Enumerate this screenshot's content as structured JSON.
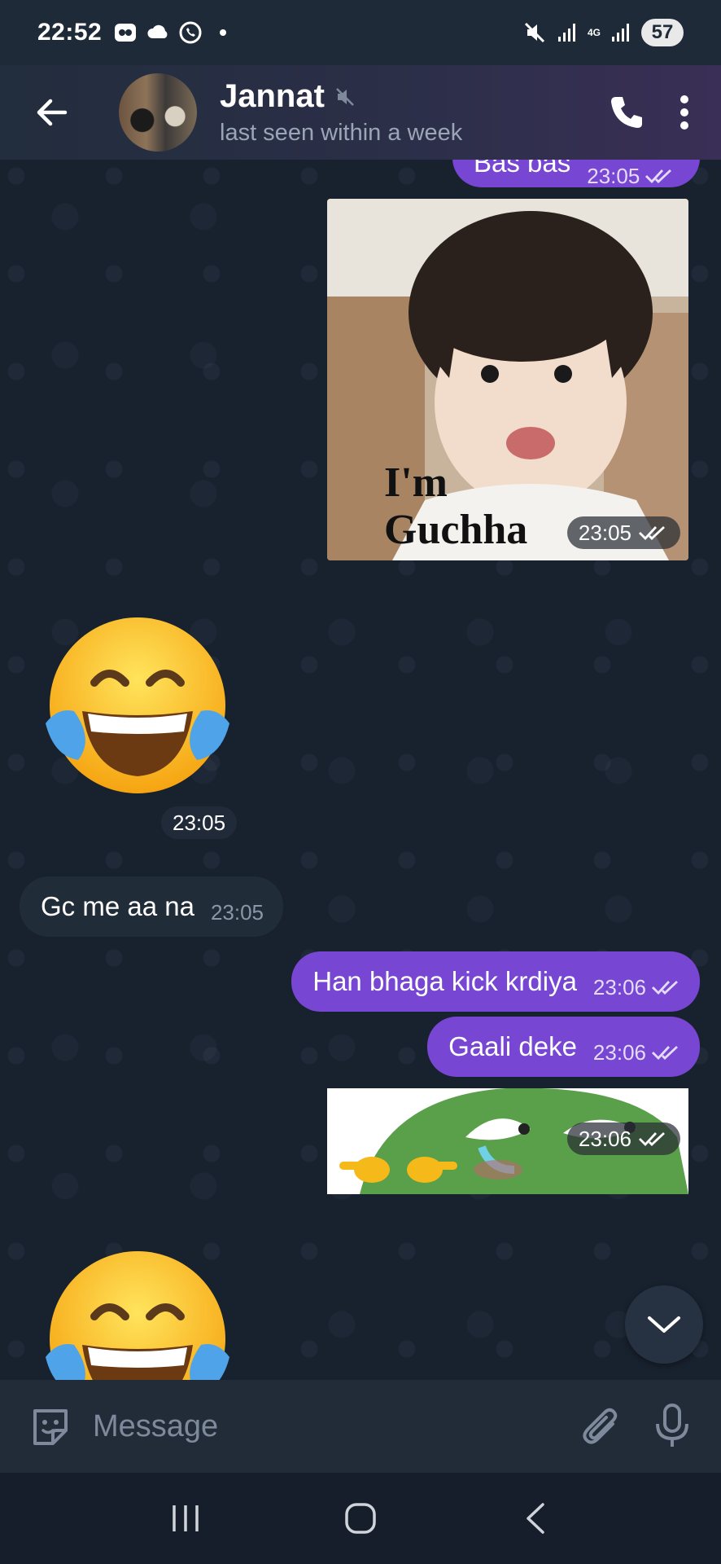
{
  "status_bar": {
    "time": "22:52",
    "battery": "57",
    "network": "4G",
    "icons": [
      "app-icon",
      "cloud-icon",
      "whatsapp-icon",
      "dot-icon",
      "mute-icon",
      "signal-icon",
      "signal-icon"
    ]
  },
  "header": {
    "contact_name": "Jannat",
    "last_seen": "last seen within a week",
    "muted": true
  },
  "messages": {
    "top_partial": {
      "text": "Bas bas",
      "time": "23:05"
    },
    "photo": {
      "caption_line1": "I'm",
      "caption_line2": "Guchha",
      "time": "23:05"
    },
    "emoji_1": {
      "time": "23:05"
    },
    "incoming_1": {
      "text": "Gc me aa na",
      "time": "23:05"
    },
    "outgoing_1": {
      "text": "Han bhaga kick krdiya",
      "time": "23:06"
    },
    "outgoing_2": {
      "text": "Gaali deke",
      "time": "23:06"
    },
    "sticker_frog": {
      "time": "23:06"
    }
  },
  "composer": {
    "placeholder": "Message"
  },
  "colors": {
    "outgoing_bubble": "#7746d3",
    "incoming_bubble": "#212c39",
    "background": "#18212e"
  }
}
